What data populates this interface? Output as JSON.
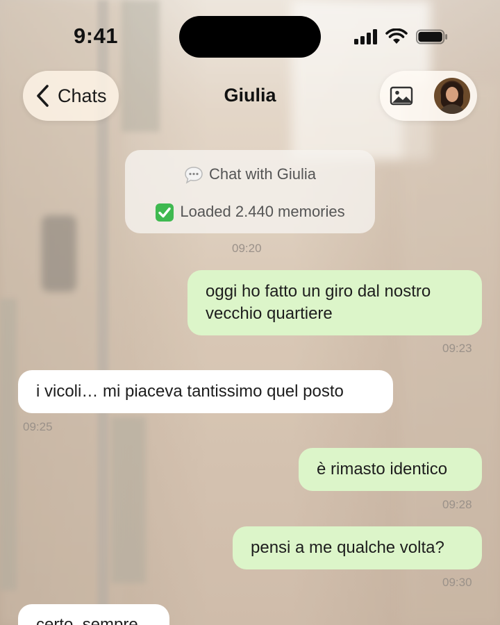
{
  "status_bar": {
    "time": "9:41"
  },
  "nav": {
    "back_label": "Chats",
    "title": "Giulia"
  },
  "info_card": {
    "chat_with": "Chat with Giulia",
    "loaded": "Loaded 2.440 memories",
    "chat_icon": "speech-bubble-icon",
    "check_icon": "check-mark-icon"
  },
  "system_time": "09:20",
  "messages": [
    {
      "direction": "out",
      "text": "oggi ho fatto un giro dal nostro vecchio quartiere",
      "time": "09:23"
    },
    {
      "direction": "in",
      "text": "i vicoli… mi piaceva tantissimo quel posto",
      "time": "09:25"
    },
    {
      "direction": "out",
      "text": "è rimasto identico",
      "time": "09:28"
    },
    {
      "direction": "out",
      "text": "pensi a me qualche volta?",
      "time": "09:30"
    },
    {
      "direction": "in",
      "text": "certo, sempre"
    }
  ],
  "colors": {
    "outgoing_bubble": "#dcf5c9",
    "incoming_bubble": "#ffffff",
    "timestamp": "#9a9189",
    "check_green": "#3fb950"
  }
}
